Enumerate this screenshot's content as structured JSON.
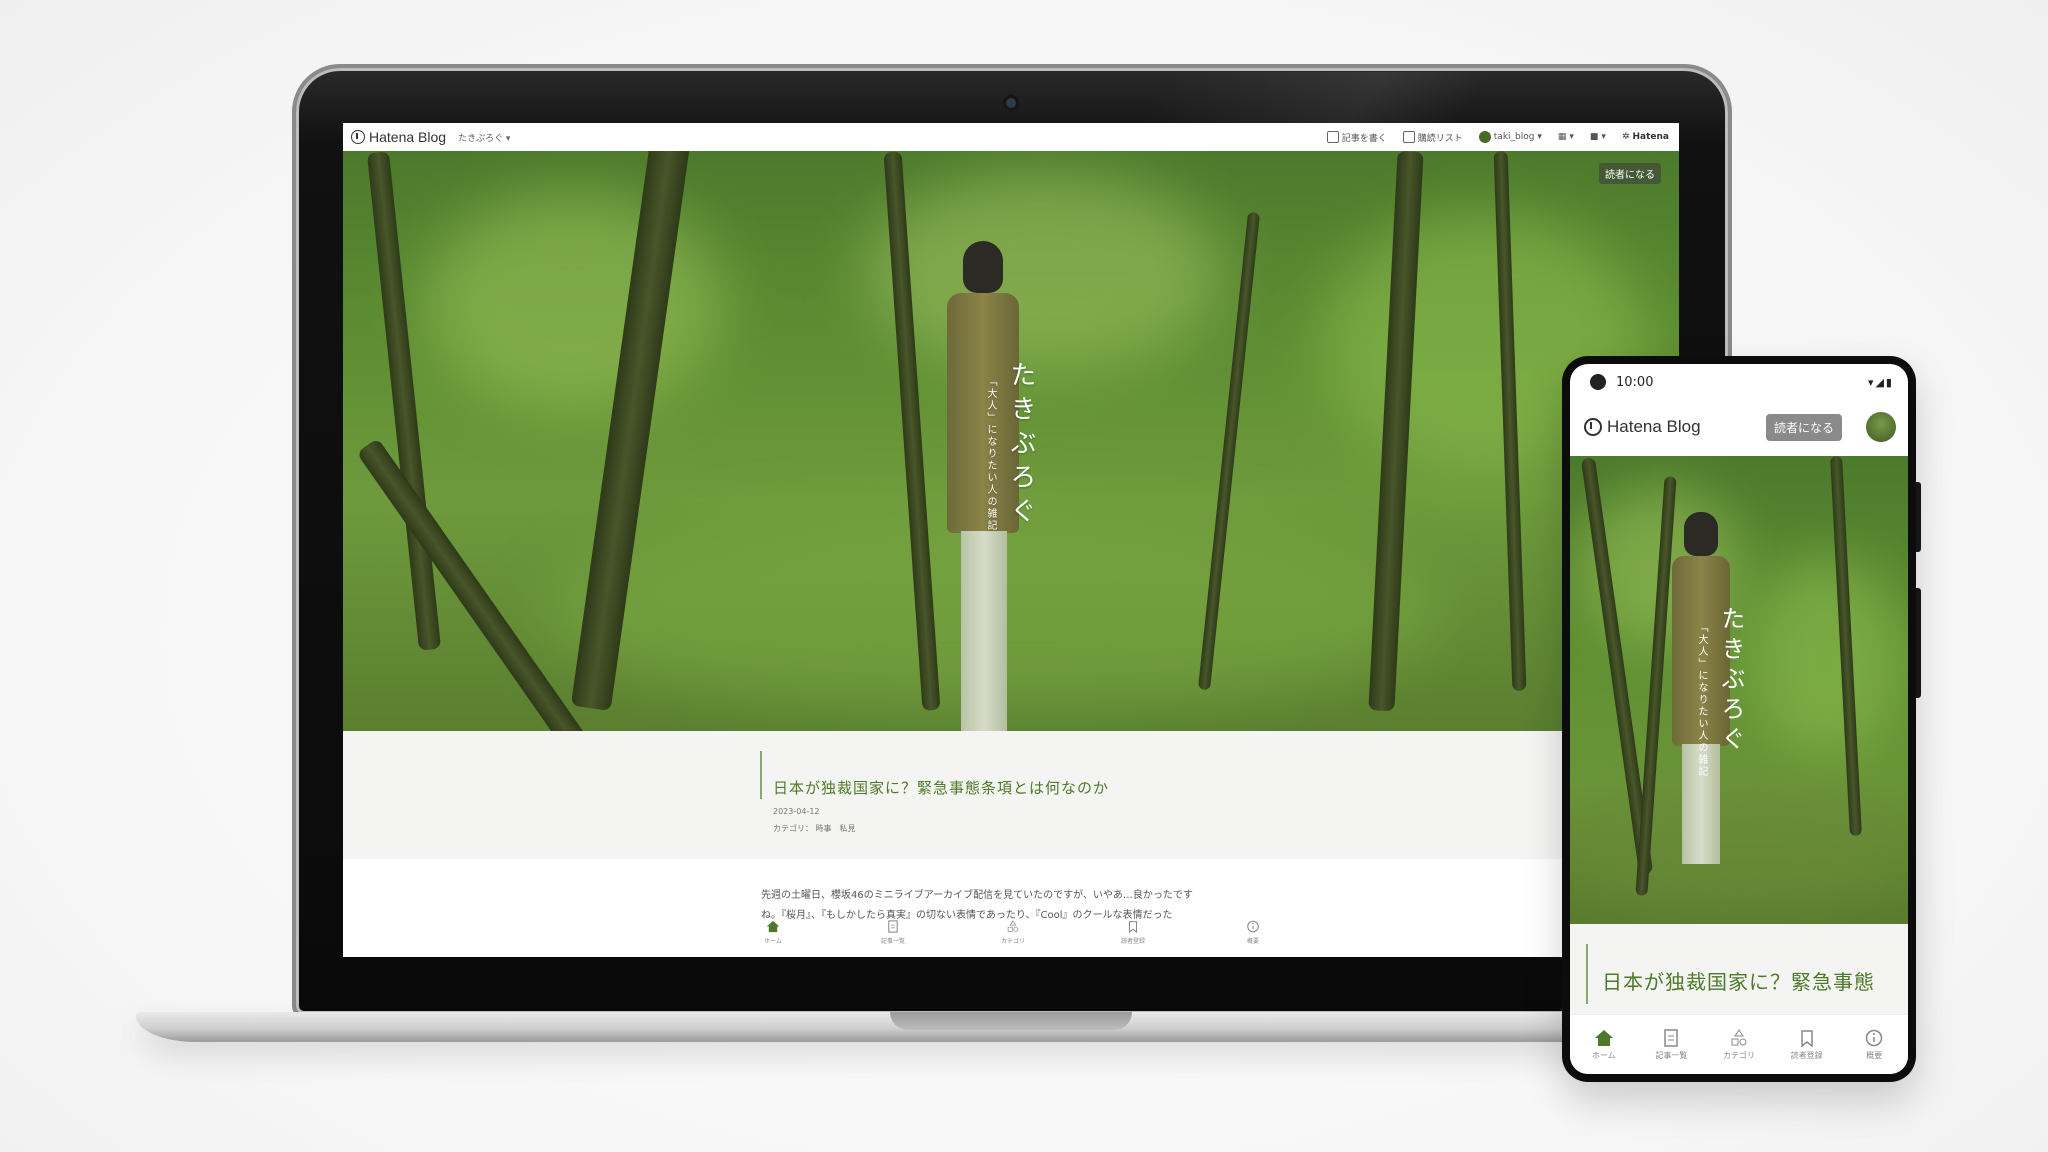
{
  "desktop": {
    "topbar": {
      "brand": "Hatena Blog",
      "blog_menu": "たきぶろぐ ▾",
      "write_article": "記事を書く",
      "reading_list": "購読リスト",
      "user_menu": "taki_blog ▾",
      "apps_menu": "▾",
      "notifications_menu": "▾",
      "hatena": "Hatena"
    },
    "follow_button": "読者になる",
    "hero": {
      "blog_title": "たきぶろぐ",
      "tagline": "「大人」になりたい人の雑記"
    },
    "article": {
      "title": "日本が独裁国家に？緊急事態条項とは何なのか",
      "date": "2023-04-12",
      "category_label": "カテゴリ：",
      "categories": "時事　私見",
      "body_line1": "先週の土曜日、櫻坂46のミニライブアーカイブ配信を見ていたのですが、いやあ…良かったです",
      "body_line2": "ね。『桜月』、『もしかしたら真実』の切ない表情であったり、『Cool』のクールな表情だった"
    },
    "bottom_nav": [
      {
        "label": "ホーム",
        "icon": "home-icon"
      },
      {
        "label": "記事一覧",
        "icon": "document-icon"
      },
      {
        "label": "カテゴリ",
        "icon": "category-icon"
      },
      {
        "label": "読者登録",
        "icon": "bookmark-icon"
      },
      {
        "label": "概要",
        "icon": "info-icon"
      }
    ]
  },
  "mobile": {
    "status_time": "10:00",
    "status_icons": "▾◢▮",
    "brand": "Hatena Blog",
    "follow_button": "読者になる",
    "hero": {
      "blog_title": "たきぶろぐ",
      "tagline": "「大人」になりたい人の雑記"
    },
    "article_title": "日本が独裁国家に？緊急事態",
    "bottom_nav": [
      {
        "label": "ホーム"
      },
      {
        "label": "記事一覧"
      },
      {
        "label": "カテゴリ"
      },
      {
        "label": "読者登録"
      },
      {
        "label": "概要"
      }
    ]
  },
  "colors": {
    "accent_green": "#4d7a2a",
    "hero_green": "#5f8f33",
    "follow_button_bg": "#8a8a8a"
  }
}
